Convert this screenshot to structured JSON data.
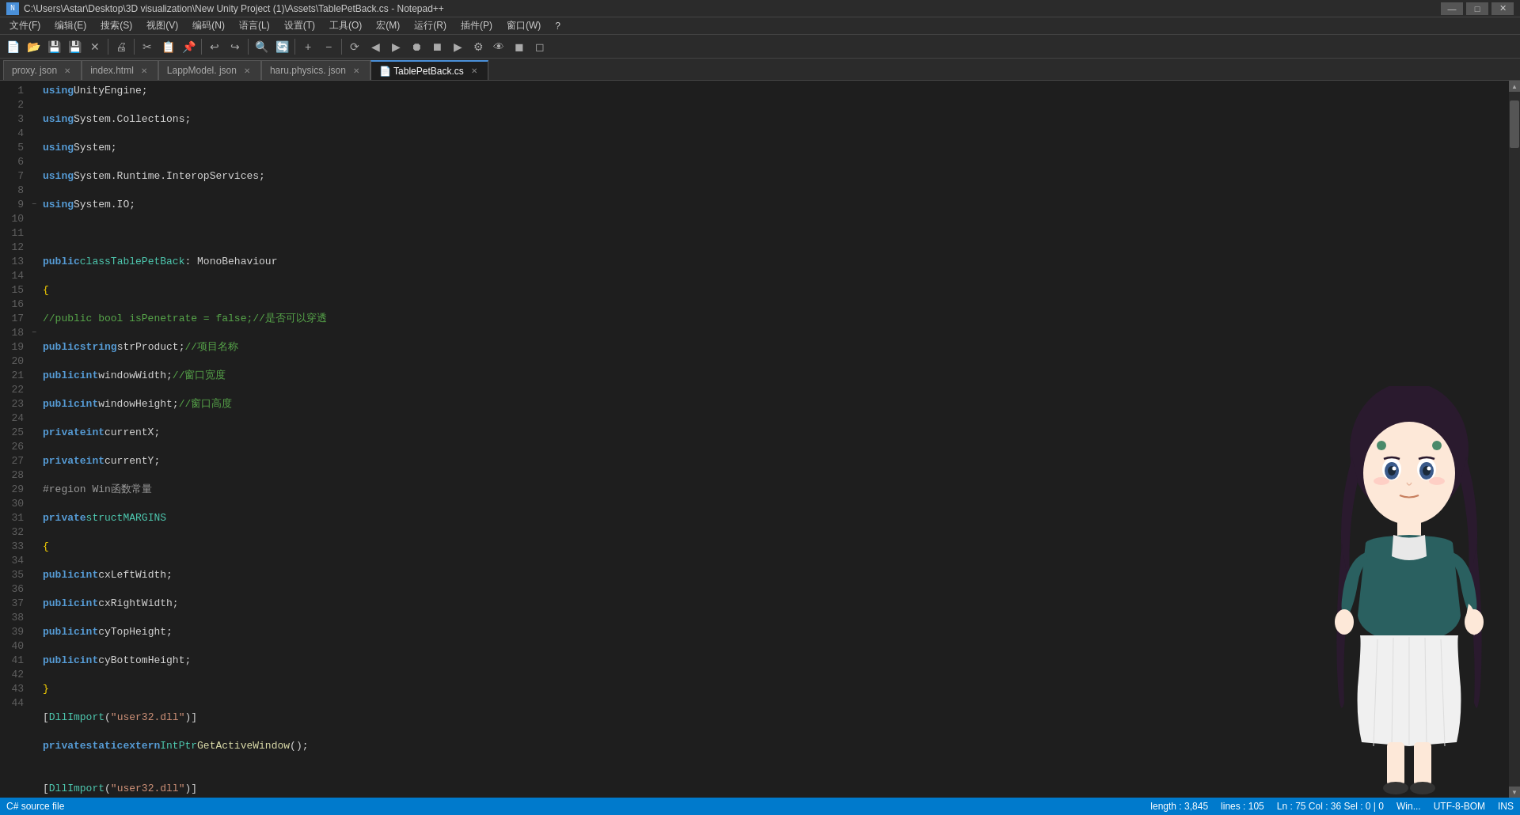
{
  "titlebar": {
    "title": "C:\\Users\\Astar\\Desktop\\3D visualization\\New Unity Project (1)\\Assets\\TablePetBack.cs - Notepad++",
    "icon": "N",
    "minimize": "—",
    "maximize": "□",
    "close": "✕"
  },
  "menubar": {
    "items": [
      "文件(F)",
      "编辑(E)",
      "搜索(S)",
      "视图(V)",
      "编码(N)",
      "语言(L)",
      "设置(T)",
      "工具(O)",
      "宏(M)",
      "运行(R)",
      "插件(P)",
      "窗口(W)",
      "?"
    ]
  },
  "tabs": [
    {
      "label": "proxy.json",
      "modified": true,
      "active": false
    },
    {
      "label": "index.html",
      "modified": true,
      "active": false
    },
    {
      "label": "LappModel.json",
      "modified": true,
      "active": false
    },
    {
      "label": "haru.physics.json",
      "modified": true,
      "active": false
    },
    {
      "label": "TablePetBack.cs",
      "modified": true,
      "active": true
    }
  ],
  "statusbar": {
    "filetype": "C# source file",
    "length": "length : 3,845",
    "lines": "lines : 105",
    "position": "Ln : 75   Col : 36   Sel : 0 | 0",
    "windows": "Win...",
    "encoding": "UTF-8-BOM",
    "eol": "INS"
  }
}
